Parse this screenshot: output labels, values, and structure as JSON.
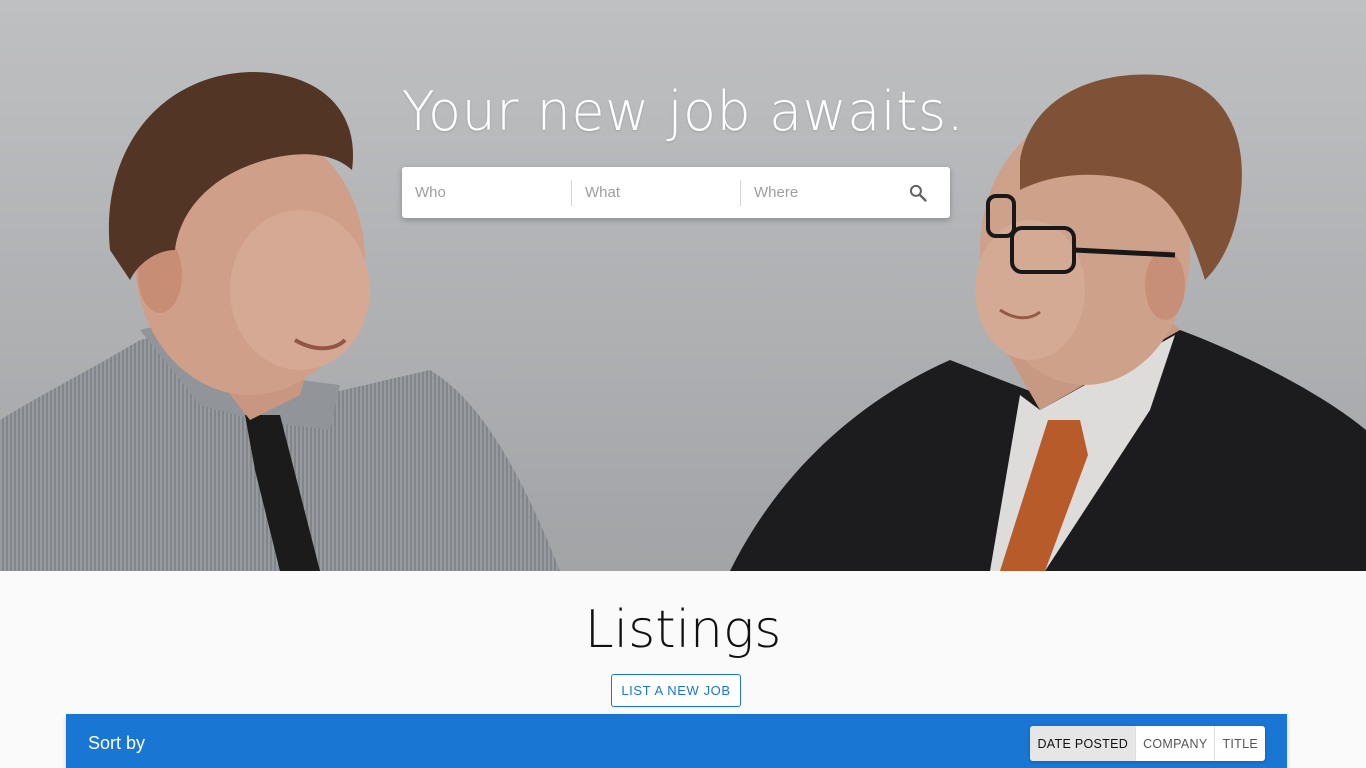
{
  "hero": {
    "title": "Your new job awaits.",
    "search": {
      "who_placeholder": "Who",
      "what_placeholder": "What",
      "where_placeholder": "Where",
      "button_icon": "search-icon"
    }
  },
  "listings": {
    "title": "Listings",
    "new_job_button": "LIST A NEW JOB"
  },
  "sort_bar": {
    "label": "Sort by",
    "options": [
      "DATE POSTED",
      "COMPANY",
      "TITLE"
    ],
    "selected": "DATE POSTED"
  },
  "colors": {
    "accent": "#1976d2",
    "hero_background": "#bfc1c3",
    "page_background": "#fafafa"
  }
}
